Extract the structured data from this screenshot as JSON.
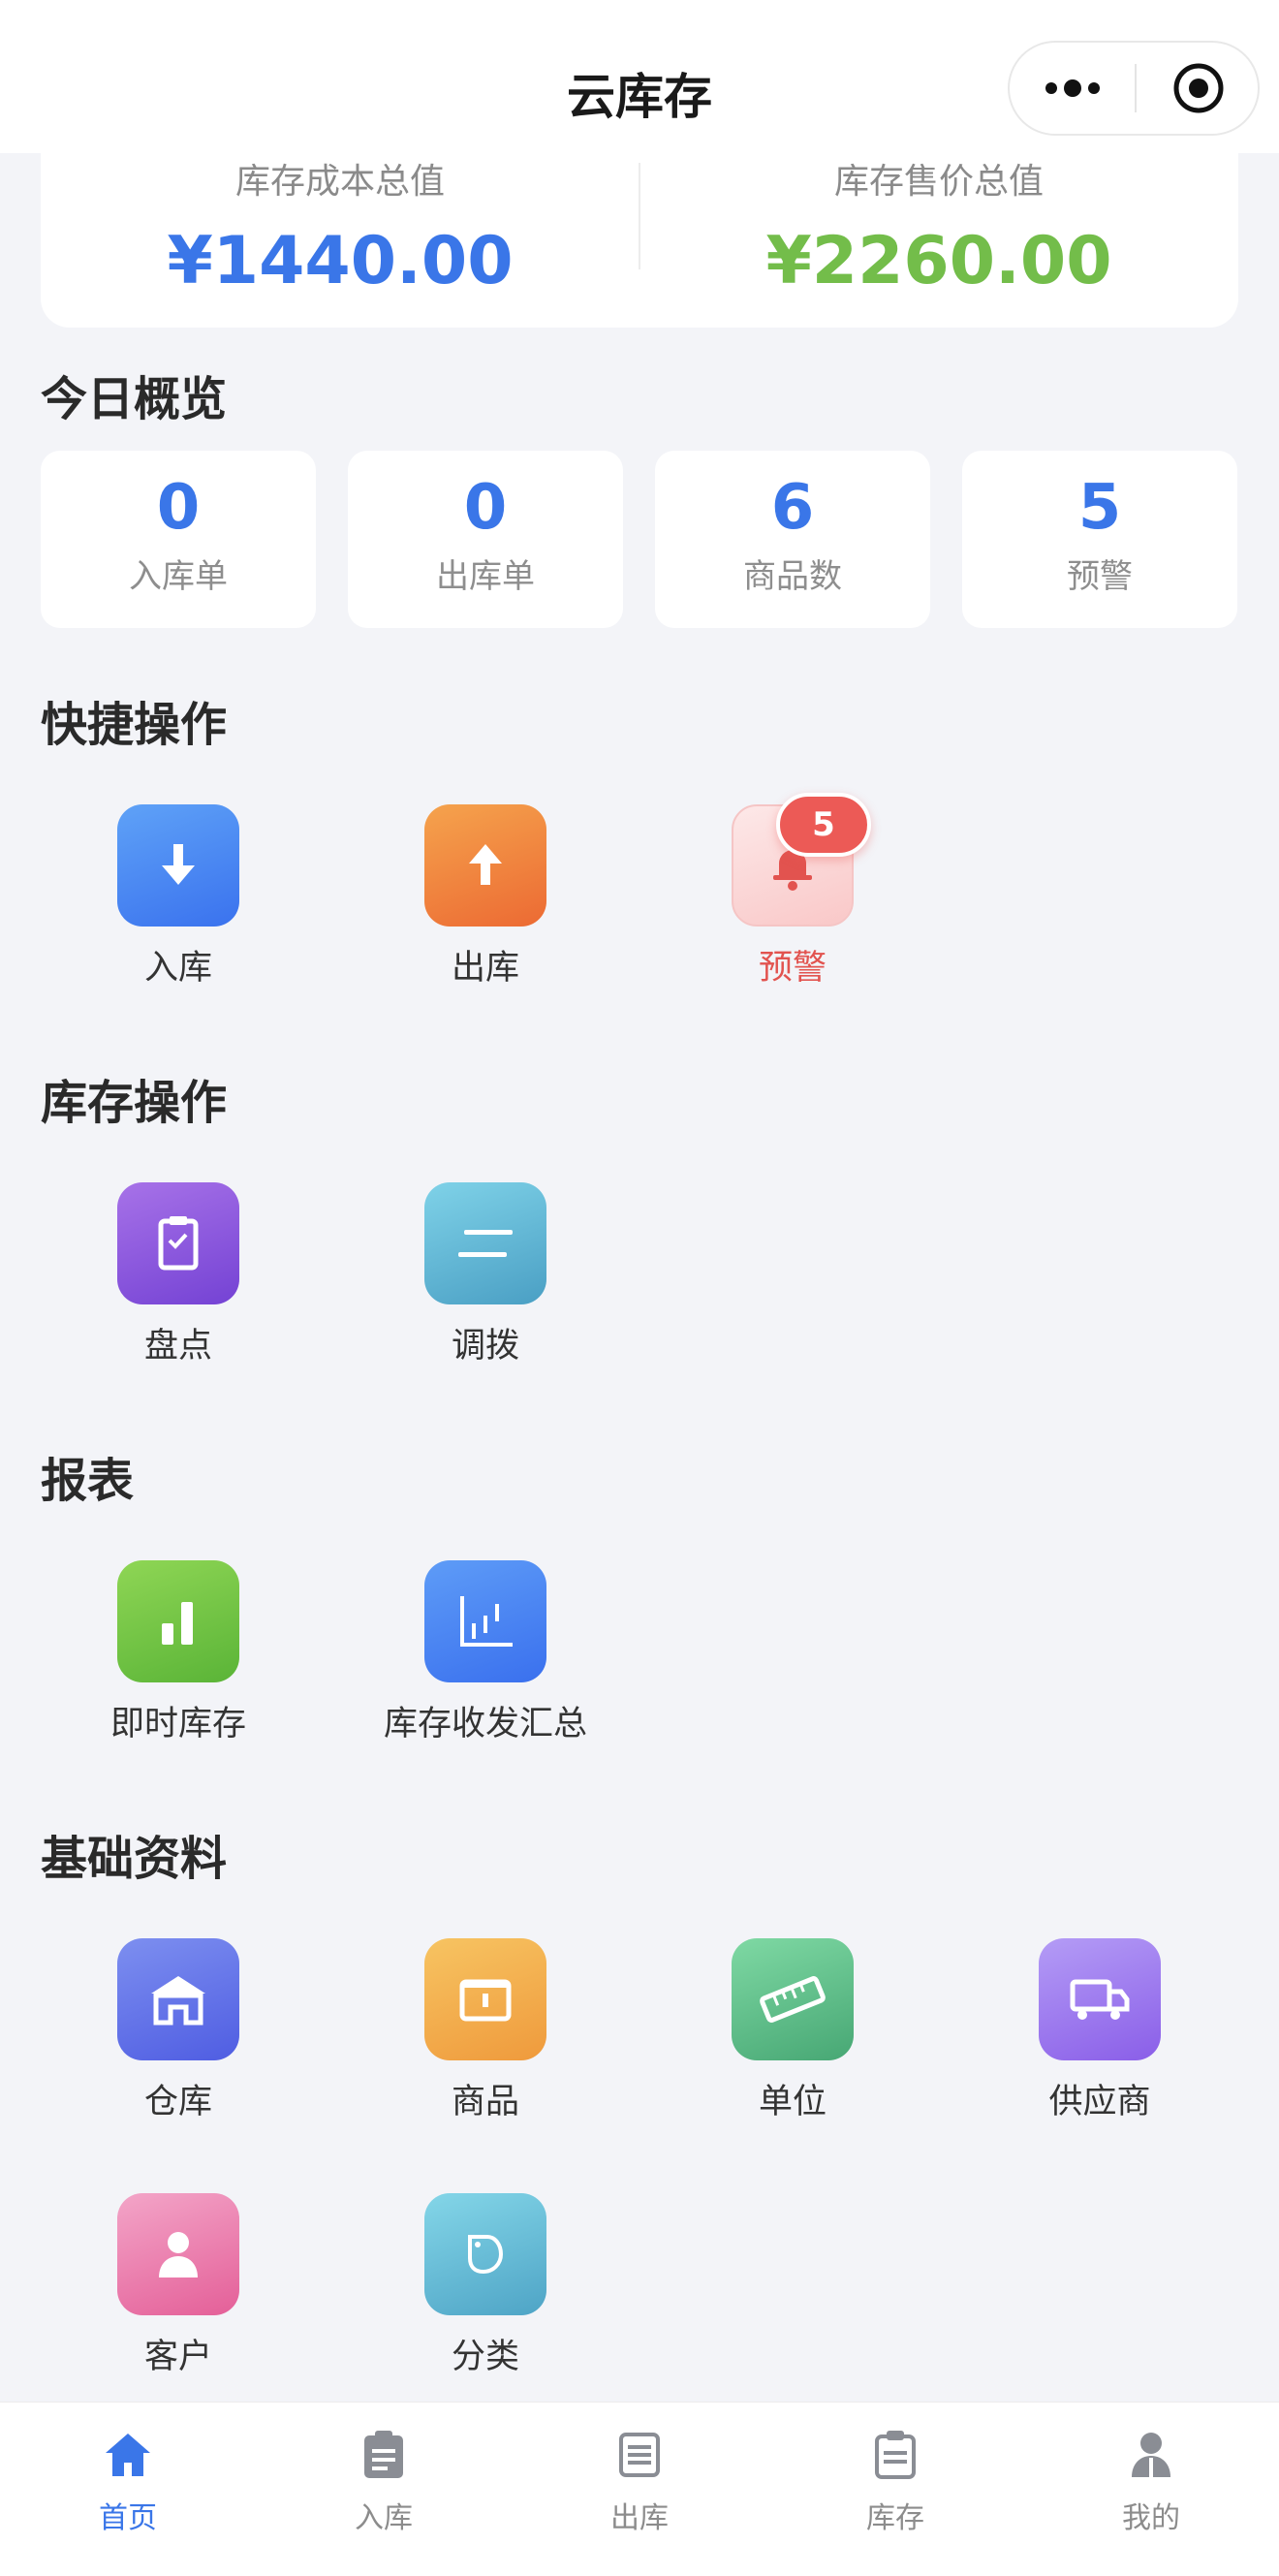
{
  "nav": {
    "title": "云库存"
  },
  "value_card": {
    "cost_label": "库存成本总值",
    "cost_value": "¥1440.00",
    "price_label": "库存售价总值",
    "price_value": "¥2260.00",
    "colors": {
      "cost": "#3a76e8",
      "price": "#73bd4a"
    }
  },
  "overview": {
    "title": "今日概览",
    "cards": [
      {
        "value": "0",
        "label": "入库单"
      },
      {
        "value": "0",
        "label": "出库单"
      },
      {
        "value": "6",
        "label": "商品数"
      },
      {
        "value": "5",
        "label": "预警"
      }
    ]
  },
  "quick_ops": {
    "title": "快捷操作",
    "items": [
      {
        "label": "入库",
        "icon": "arrow-down-icon"
      },
      {
        "label": "出库",
        "icon": "arrow-up-icon"
      },
      {
        "label": "预警",
        "icon": "bell-icon",
        "badge": "5"
      }
    ]
  },
  "stock_ops": {
    "title": "库存操作",
    "items": [
      {
        "label": "盘点",
        "icon": "clipboard-check-icon"
      },
      {
        "label": "调拨",
        "icon": "transfer-icon"
      }
    ]
  },
  "reports": {
    "title": "报表",
    "items": [
      {
        "label": "即时库存",
        "icon": "bar-chart-icon"
      },
      {
        "label": "库存收发汇总",
        "icon": "chart-axes-icon"
      }
    ]
  },
  "basic_data": {
    "title": "基础资料",
    "items": [
      {
        "label": "仓库",
        "icon": "warehouse-icon"
      },
      {
        "label": "商品",
        "icon": "box-icon"
      },
      {
        "label": "单位",
        "icon": "ruler-icon"
      },
      {
        "label": "供应商",
        "icon": "truck-icon"
      },
      {
        "label": "客户",
        "icon": "person-icon"
      },
      {
        "label": "分类",
        "icon": "tag-icon"
      }
    ]
  },
  "tabbar": {
    "active_color": "#3a76e8",
    "items": [
      {
        "label": "首页",
        "icon": "home-icon",
        "active": true
      },
      {
        "label": "入库",
        "icon": "clipboard-icon"
      },
      {
        "label": "出库",
        "icon": "list-icon"
      },
      {
        "label": "库存",
        "icon": "inventory-icon"
      },
      {
        "label": "我的",
        "icon": "user-icon"
      }
    ]
  }
}
